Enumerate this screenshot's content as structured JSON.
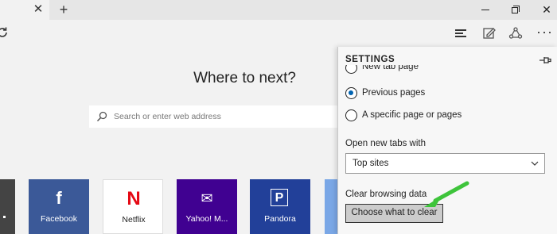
{
  "tabstrip": {
    "tab_close_glyph": "✕",
    "new_tab_glyph": "+",
    "window_close_glyph": "✕"
  },
  "toolbar": {
    "more_glyph": "···",
    "icons": [
      "refresh-icon",
      "hub-icon",
      "web-note-icon",
      "share-icon",
      "more-icon"
    ]
  },
  "ntp": {
    "heading": "Where to next?",
    "search_placeholder": "Search or enter web address",
    "tiles": [
      {
        "label": "Facebook",
        "glyph": "f",
        "color": "#3b5998"
      },
      {
        "label": "Netflix",
        "glyph": "N",
        "color": "#e50914"
      },
      {
        "label": "Yahoo! M...",
        "glyph": "✉",
        "color": "#400191"
      },
      {
        "label": "Pandora",
        "glyph": "P",
        "color": "#224099"
      }
    ]
  },
  "settings": {
    "title": "SETTINGS",
    "open_with_options": [
      {
        "label": "New tab page",
        "selected": false
      },
      {
        "label": "Previous pages",
        "selected": true
      },
      {
        "label": "A specific page or pages",
        "selected": false
      }
    ],
    "new_tabs_label": "Open new tabs with",
    "new_tabs_value": "Top sites",
    "clear_label": "Clear browsing data",
    "clear_button": "Choose what to clear",
    "annotation_arrow_color": "#3ec43b"
  }
}
